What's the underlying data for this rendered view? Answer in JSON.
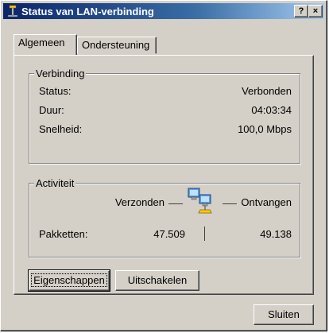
{
  "window": {
    "title": "Status van LAN-verbinding",
    "help_label": "?",
    "close_label": "×"
  },
  "tabs": [
    {
      "label": "Algemeen",
      "active": true
    },
    {
      "label": "Ondersteuning",
      "active": false
    }
  ],
  "connection": {
    "legend": "Verbinding",
    "rows": [
      {
        "label": "Status:",
        "value": "Verbonden"
      },
      {
        "label": "Duur:",
        "value": "04:03:34"
      },
      {
        "label": "Snelheid:",
        "value": "100,0 Mbps"
      }
    ]
  },
  "activity": {
    "legend": "Activiteit",
    "sent_label": "Verzonden",
    "received_label": "Ontvangen",
    "packets_label": "Pakketten:",
    "packets_sent": "47.509",
    "packets_received": "49.138"
  },
  "buttons": {
    "properties": "Eigenschappen",
    "disable": "Uitschakelen",
    "close": "Sluiten"
  },
  "icons": {
    "title": "network-connection-icon",
    "activity": "network-activity-icon"
  }
}
